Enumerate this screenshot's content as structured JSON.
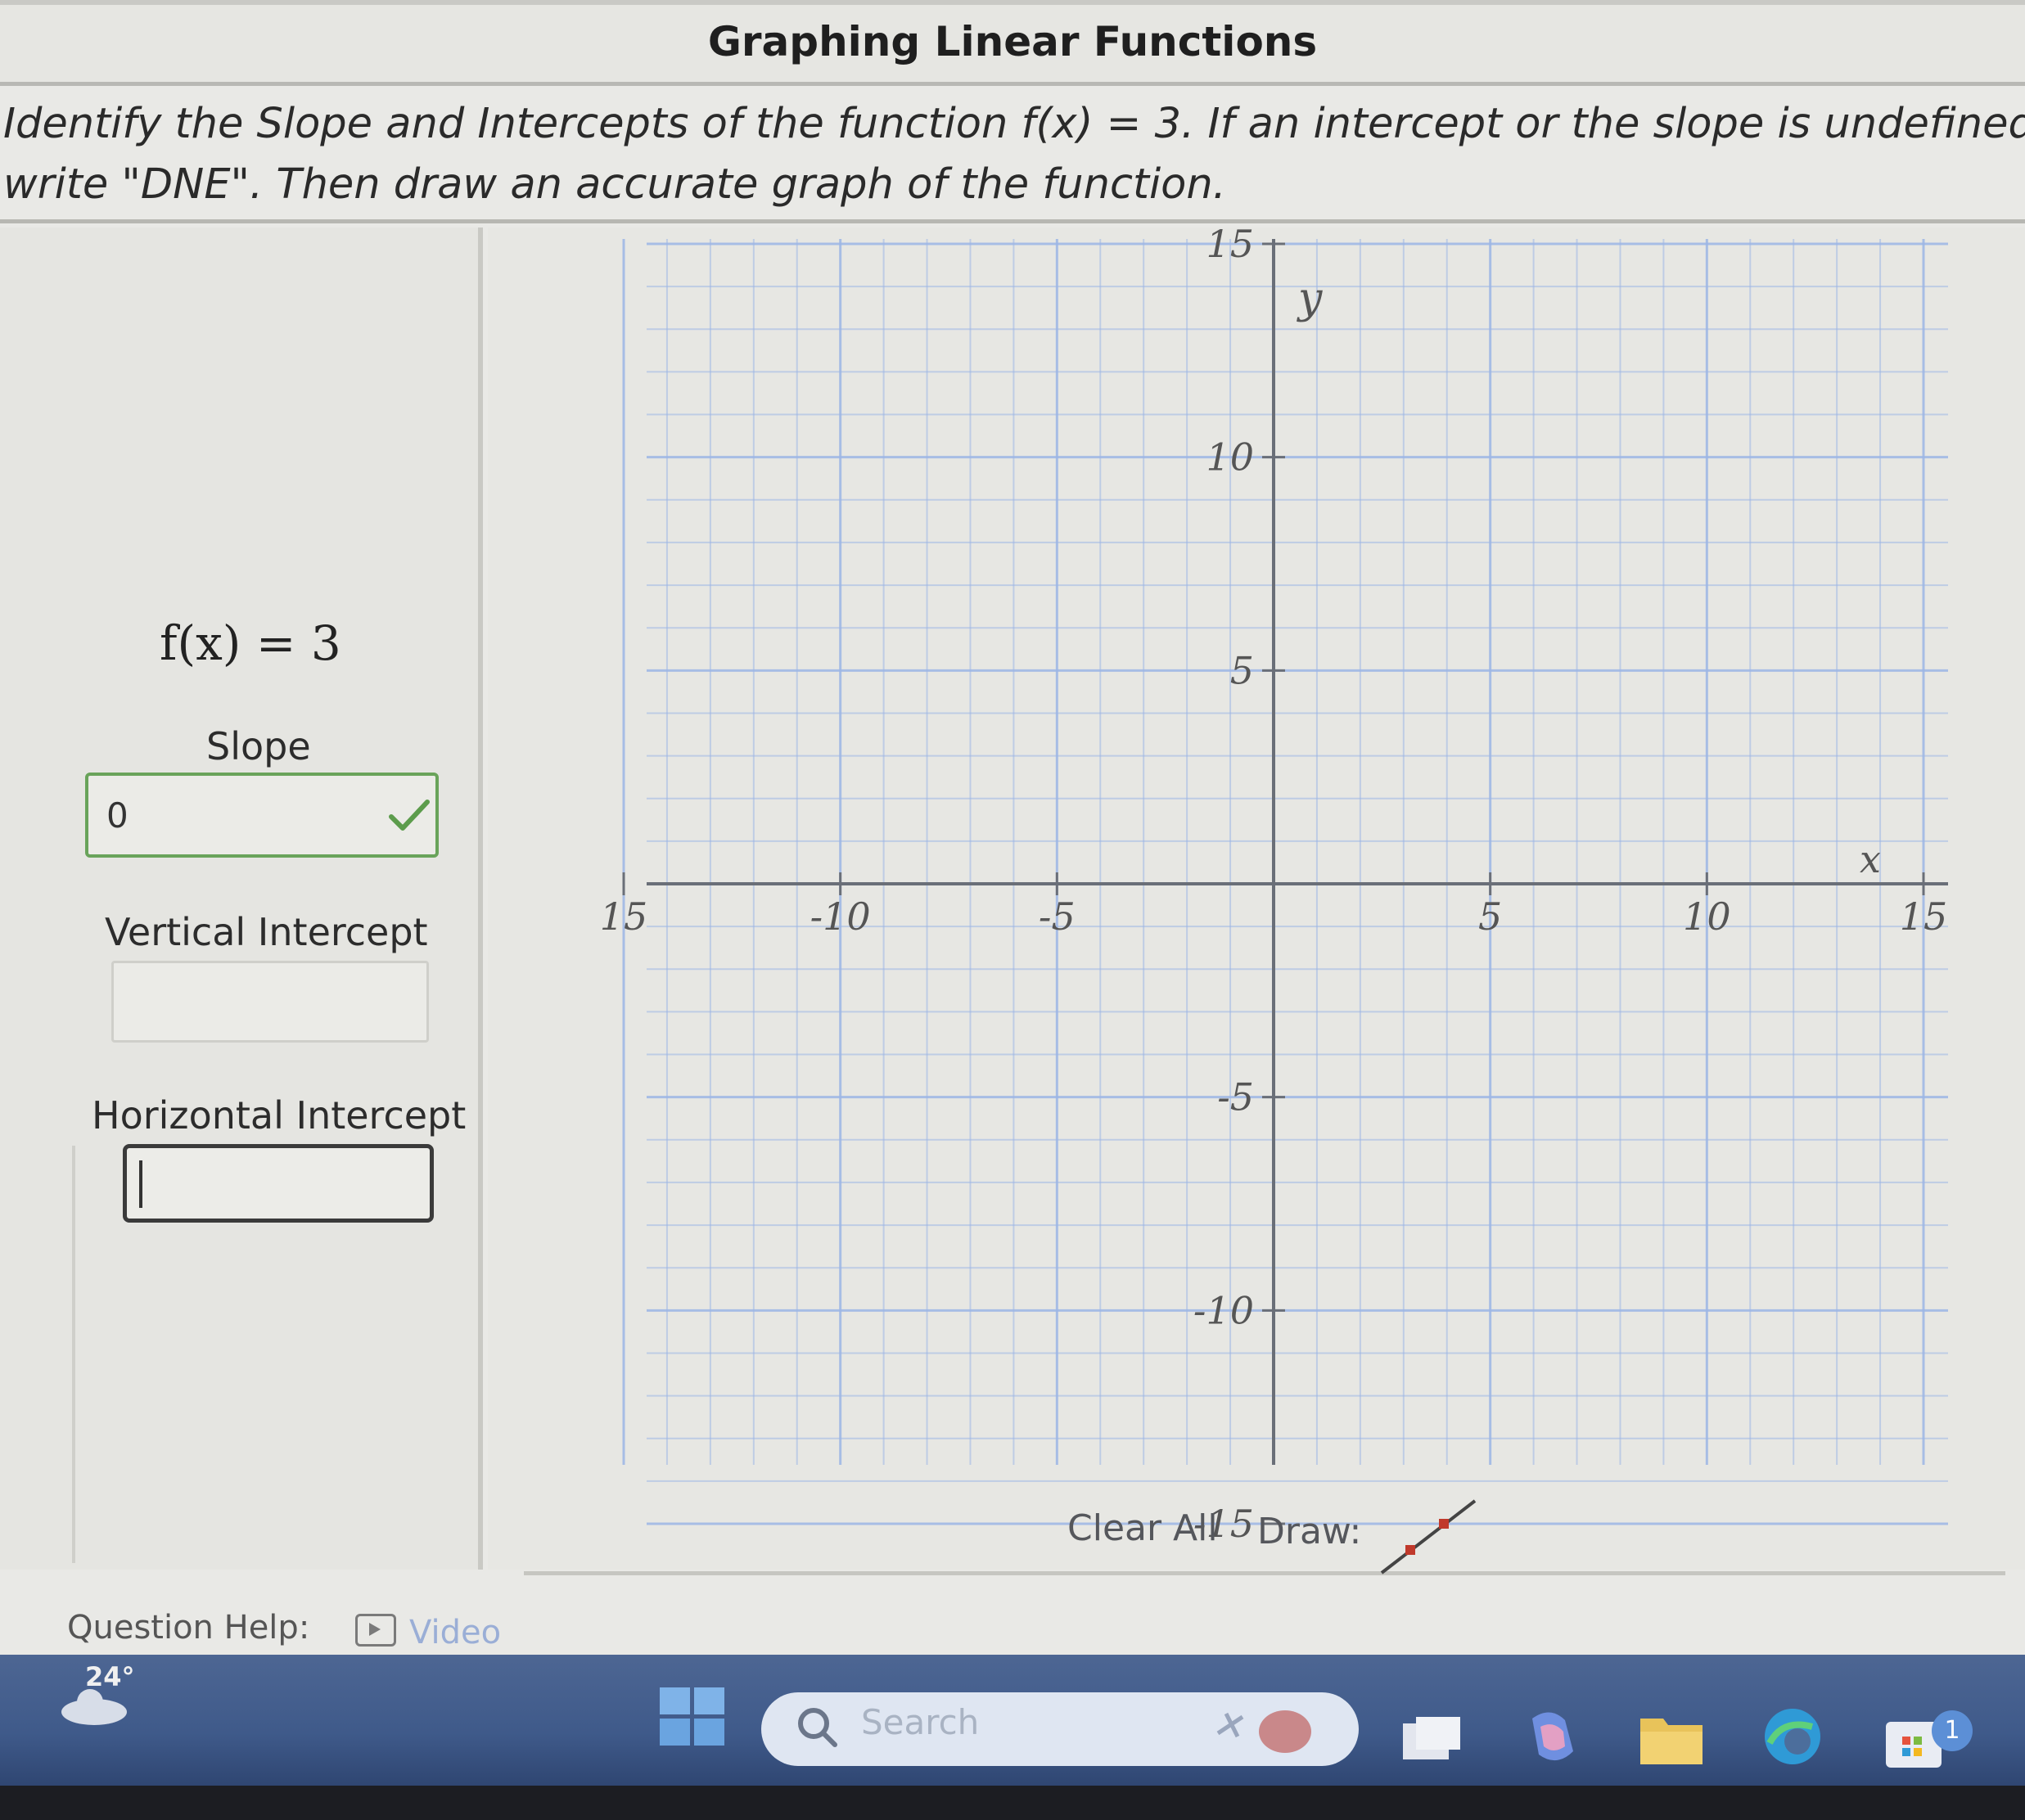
{
  "header": {
    "title": "Graphing Linear Functions"
  },
  "instructions": {
    "line1": "Identify the Slope and Intercepts of the function f(x) = 3. If an intercept or the slope is undefined,",
    "line2": "write \"DNE\". Then draw an accurate graph of the function."
  },
  "left_panel": {
    "function": "f(x) = 3",
    "slope": {
      "label": "Slope",
      "value": "0",
      "status": "correct"
    },
    "vertical_intercept": {
      "label": "Vertical Intercept",
      "value": ""
    },
    "horizontal_intercept": {
      "label": "Horizontal Intercept",
      "value": ""
    }
  },
  "graph": {
    "x_axis_label": "x",
    "y_axis_label": "y",
    "x_range": [
      -15,
      15
    ],
    "y_range": [
      -15,
      15
    ],
    "x_tick_labels": [
      "15",
      "-10",
      "-5",
      "5",
      "10",
      "15"
    ],
    "y_tick_labels": [
      "15",
      "10",
      "5",
      "-5",
      "-10",
      "-15"
    ],
    "grid": true,
    "grid_color": "#9db6e6"
  },
  "controls": {
    "clear_all": "Clear All",
    "draw_label": "Draw:",
    "tool_icon": "line-segment-tool-icon"
  },
  "help": {
    "label": "Question Help:",
    "video": "Video"
  },
  "taskbar": {
    "weather_temp": "24°",
    "search_placeholder": "Search",
    "store_badge": "1"
  }
}
